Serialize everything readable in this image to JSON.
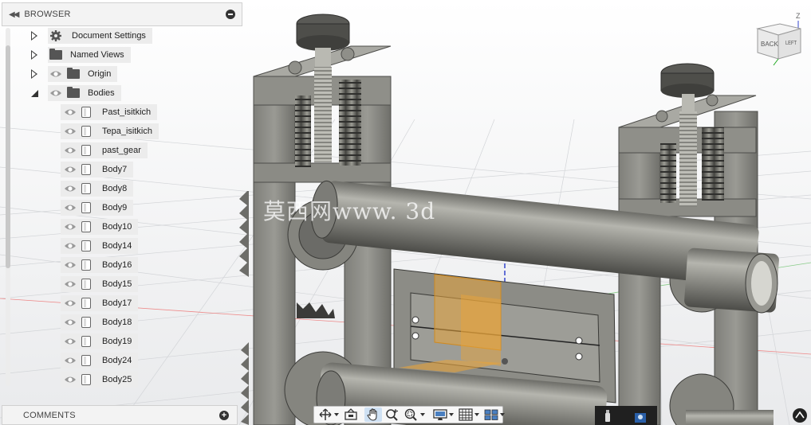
{
  "browser": {
    "title": "BROWSER",
    "items": [
      {
        "label": "Document Settings",
        "icon": "gear-icon",
        "expand": "collapsed",
        "eye": false
      },
      {
        "label": "Named Views",
        "icon": "folder-icon",
        "expand": "collapsed",
        "eye": false
      },
      {
        "label": "Origin",
        "icon": "folder-icon",
        "expand": "collapsed",
        "eye": true
      },
      {
        "label": "Bodies",
        "icon": "folder-icon",
        "expand": "expanded",
        "eye": true
      }
    ],
    "bodies": [
      "Past_isitkich",
      "Tepa_isitkich",
      "past_gear",
      "Body7",
      "Body8",
      "Body9",
      "Body10",
      "Body14",
      "Body16",
      "Body15",
      "Body17",
      "Body18",
      "Body19",
      "Body24",
      "Body25"
    ]
  },
  "comments": {
    "title": "COMMENTS"
  },
  "viewcube": {
    "back": "BACK",
    "left": "LEFT",
    "axis": "Z"
  },
  "watermark": "莫西网www. 3d",
  "colors": {
    "accent": "#cfe1f3",
    "model_gray": "#8c8c86",
    "highlight": "#e8a43a"
  },
  "toolbar": {
    "tools": [
      "orbit-icon",
      "look-at-icon",
      "pan-icon",
      "zoom-icon",
      "fit-icon",
      "display-settings-icon",
      "grid-icon",
      "viewports-icon"
    ]
  }
}
